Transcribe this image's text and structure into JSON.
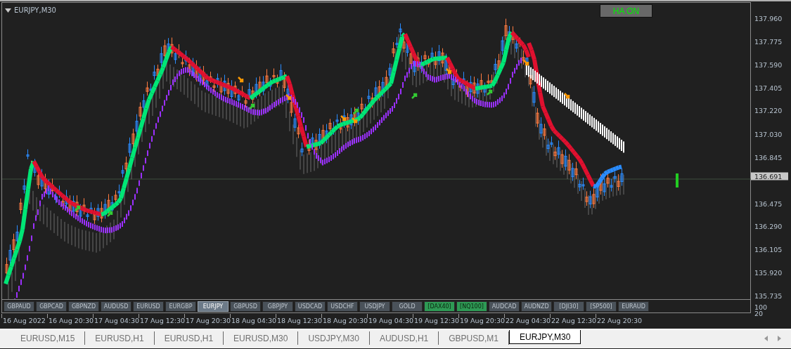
{
  "chart": {
    "title": "EURJPY,M30",
    "ha_button": "HA ON"
  },
  "price_axis": {
    "ticks": [
      "137.960",
      "137.775",
      "137.590",
      "137.405",
      "137.220",
      "137.030",
      "136.845",
      "136.475",
      "136.290",
      "136.105",
      "135.920",
      "135.735"
    ],
    "current_price": "136.691"
  },
  "symbol_buttons": [
    {
      "label": "GBPAUD",
      "selected": false,
      "active": false
    },
    {
      "label": "GBPCAD",
      "selected": false,
      "active": false
    },
    {
      "label": "GBPNZD",
      "selected": false,
      "active": false
    },
    {
      "label": "AUDUSD",
      "selected": false,
      "active": false
    },
    {
      "label": "EURUSD",
      "selected": false,
      "active": false
    },
    {
      "label": "EURGBP",
      "selected": false,
      "active": false
    },
    {
      "label": "EURJPY",
      "selected": true,
      "active": false
    },
    {
      "label": "GBPUSD",
      "selected": false,
      "active": false
    },
    {
      "label": "GBPJPY",
      "selected": false,
      "active": false
    },
    {
      "label": "USDCAD",
      "selected": false,
      "active": false
    },
    {
      "label": "USDCHF",
      "selected": false,
      "active": false
    },
    {
      "label": "USDJPY",
      "selected": false,
      "active": false
    },
    {
      "label": "GOLD",
      "selected": false,
      "active": false
    },
    {
      "label": "[DAX40]",
      "selected": false,
      "active": true
    },
    {
      "label": "[NQ100]",
      "selected": false,
      "active": true
    },
    {
      "label": "AUDCAD",
      "selected": false,
      "active": false
    },
    {
      "label": "AUDNZD",
      "selected": false,
      "active": false
    },
    {
      "label": "[DJI30]",
      "selected": false,
      "active": false
    },
    {
      "label": "[SP500]",
      "selected": false,
      "active": false
    },
    {
      "label": "EURAUD",
      "selected": false,
      "active": false
    }
  ],
  "strip_axis": [
    "100",
    "20"
  ],
  "time_axis": [
    "16 Aug 2022",
    "16 Aug 20:30",
    "17 Aug 04:30",
    "17 Aug 12:30",
    "17 Aug 20:30",
    "18 Aug 04:30",
    "18 Aug 12:30",
    "18 Aug 20:30",
    "19 Aug 04:30",
    "19 Aug 12:30",
    "19 Aug 20:30",
    "22 Aug 04:30",
    "22 Aug 12:30",
    "22 Aug 20:30"
  ],
  "tabs": [
    {
      "label": "EURUSD,M15",
      "selected": false
    },
    {
      "label": "EURUSD,H1",
      "selected": false
    },
    {
      "label": "EURUSD,H1",
      "selected": false
    },
    {
      "label": "EURUSD,M30",
      "selected": false
    },
    {
      "label": "USDJPY,M30",
      "selected": false
    },
    {
      "label": "AUDUSD,H1",
      "selected": false
    },
    {
      "label": "GBPUSD,M1",
      "selected": false
    },
    {
      "label": "EURJPY,M30",
      "selected": true
    }
  ]
}
